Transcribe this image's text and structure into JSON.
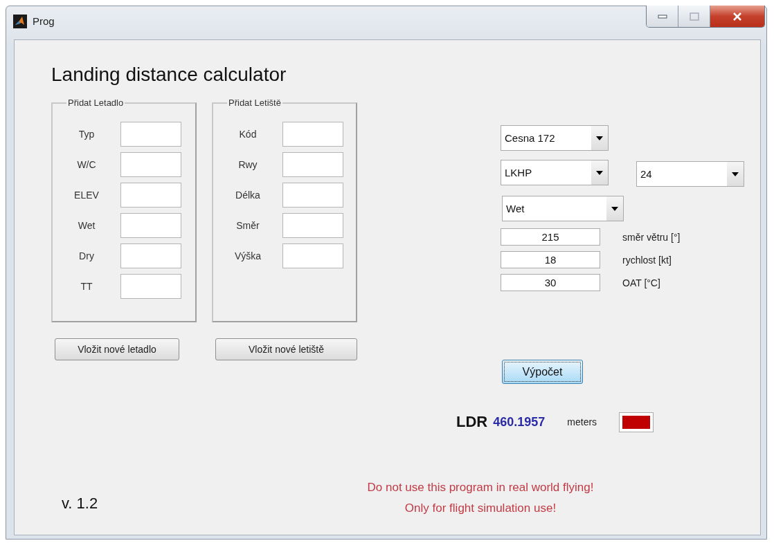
{
  "window": {
    "title": "Prog"
  },
  "heading": "Landing distance calculator",
  "groups": [
    {
      "title": "Přidat Letadlo",
      "fields": [
        {
          "label": "Typ"
        },
        {
          "label": "W/C"
        },
        {
          "label": "ELEV"
        },
        {
          "label": "Wet"
        },
        {
          "label": "Dry"
        },
        {
          "label": "TT"
        }
      ],
      "button": "Vložit nové letadlo"
    },
    {
      "title": "Přidat Letiště",
      "fields": [
        {
          "label": "Kód"
        },
        {
          "label": "Rwy"
        },
        {
          "label": "Délka"
        },
        {
          "label": "Směr"
        },
        {
          "label": "Výška"
        }
      ],
      "button": "Vložit nové letiště"
    }
  ],
  "selectors": {
    "aircraft": "Cesna 172",
    "airport": "LKHP",
    "runway": "24",
    "surface": "Wet"
  },
  "inputs": [
    {
      "value": "215",
      "label": "směr větru [°]"
    },
    {
      "value": "18",
      "label": "rychlost [kt]"
    },
    {
      "value": "30",
      "label": "OAT [°C]"
    }
  ],
  "calculate_button": {
    "label": "Výpočet",
    "focused": true
  },
  "result": {
    "label": "LDR",
    "value": "460.1957",
    "unit": "meters",
    "color": "#c00000"
  },
  "version": "v. 1.2",
  "warning": [
    "Do not use this program in real world flying!",
    "Only for flight simulation use!"
  ]
}
